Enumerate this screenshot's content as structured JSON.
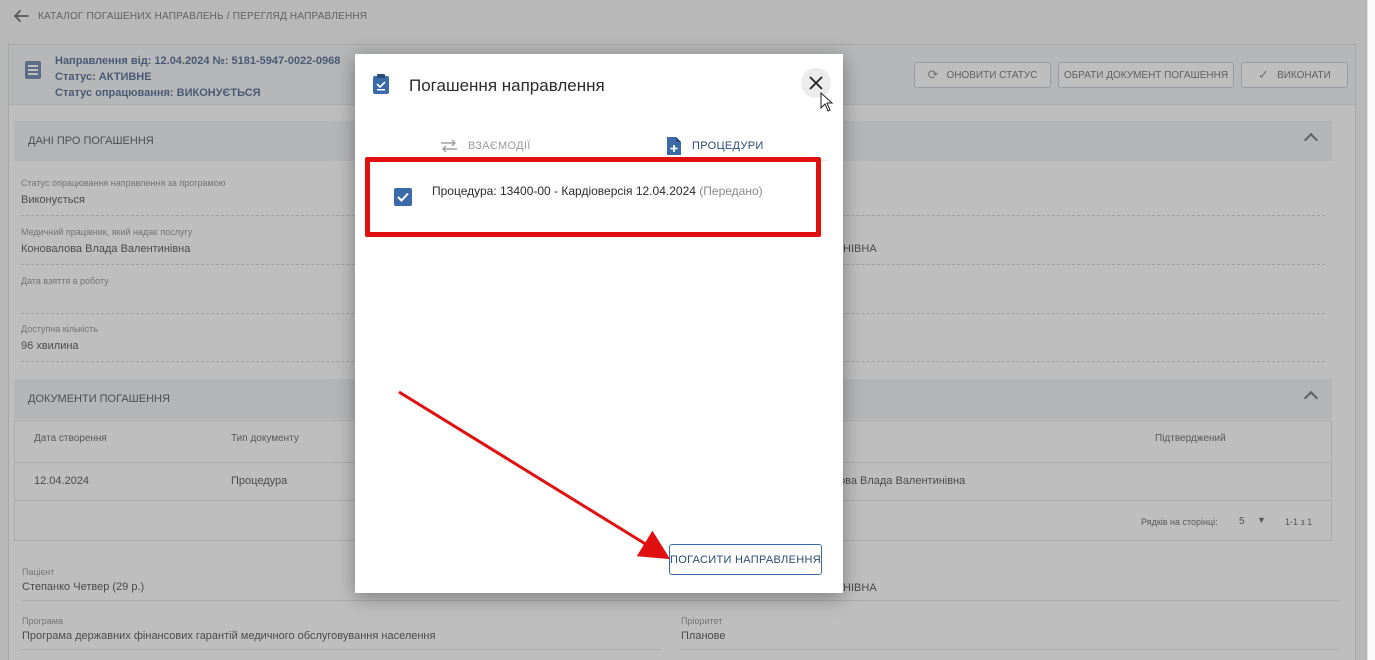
{
  "breadcrumb": "КАТАЛОГ ПОГАШЕНИХ НАПРАВЛЕНЬ / ПЕРЕГЛЯД НАПРАВЛЕННЯ",
  "header": {
    "line1": "Направлення від: 12.04.2024 №: 5181-5947-0022-0968",
    "line2": "Статус: АКТИВНЕ",
    "line3": "Статус опрацювання: ВИКОНУЄТЬСЯ",
    "btn_refresh": "ОНОВИТИ СТАТУС",
    "btn_choose": "ОБРАТИ ДОКУМЕНТ ПОГАШЕННЯ",
    "btn_execute": "ВИКОНАТИ"
  },
  "section_repay": {
    "title": "ДАНІ ПРО ПОГАШЕННЯ",
    "fields": [
      {
        "label": "Статус опрацювання направлення за програмою",
        "value": "Виконується"
      },
      {
        "label": "Медичний працівник, який надає послугу",
        "value": "Коновалова Влада Валентинівна"
      },
      {
        "label": "Дата взяття в роботу",
        "value": ""
      },
      {
        "label": "Доступна кількість",
        "value": "96 хвилина"
      }
    ],
    "right_value": "ІНІВНА"
  },
  "section_docs": {
    "title": "ДОКУМЕНТИ ПОГАШЕННЯ",
    "columns": [
      "Дата створення",
      "Тип документу",
      "Підтверджений"
    ],
    "rows": [
      {
        "date": "12.04.2024",
        "type": "Процедура",
        "person": "ова Влада Валентинівна"
      }
    ],
    "rows_per_page_label": "Рядків на сторінці:",
    "rows_per_page": "5",
    "range": "1-1 з 1"
  },
  "patient": {
    "label": "Пацієнт",
    "value": "Степанко Четвер (29 р.)",
    "right_value": "ІНІВНА"
  },
  "program": {
    "label": "Програма",
    "value": "Програма державних фінансових гарантій медичного обслуговування населення"
  },
  "priority": {
    "label": "Пріоритет",
    "value": "Планове"
  },
  "modal": {
    "title": "Погашення направлення",
    "tab_interactions": "ВЗАЄМОДІЇ",
    "tab_procedures": "ПРОЦЕДУРИ",
    "procedure_text": "Процедура: 13400-00 - Кардіоверсія 12.04.2024",
    "procedure_status": "(Передано)",
    "submit_label": "ПОГАСИТИ НАПРАВЛЕННЯ"
  },
  "colors": {
    "accent": "#3b6aa8",
    "highlight": "#e01010",
    "dark_blue": "#2a4a7a"
  }
}
